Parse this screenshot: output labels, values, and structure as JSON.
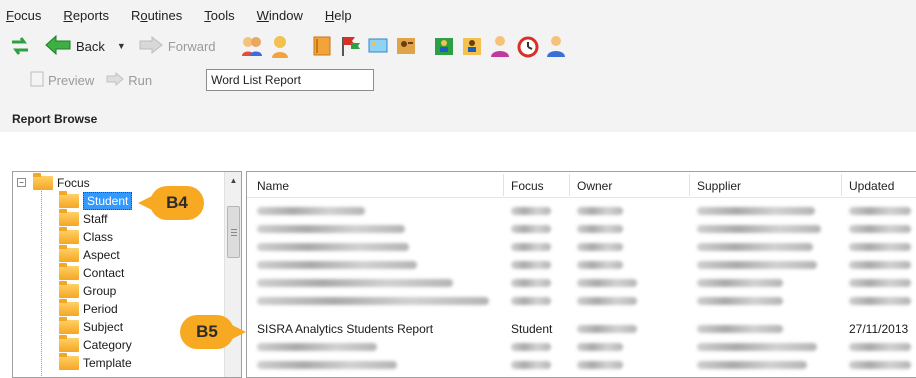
{
  "menu": [
    {
      "label": "Focus",
      "accel": "F",
      "rest": "ocus"
    },
    {
      "label": "Reports",
      "accel": "R",
      "rest": "eports"
    },
    {
      "label": "Routines",
      "accel": "o",
      "pre": "R",
      "rest": "utines"
    },
    {
      "label": "Tools",
      "accel": "T",
      "rest": "ools"
    },
    {
      "label": "Window",
      "accel": "W",
      "rest": "indow"
    },
    {
      "label": "Help",
      "accel": "H",
      "rest": "elp"
    }
  ],
  "toolbar": {
    "back_label": "Back",
    "forward_label": "Forward"
  },
  "runbar": {
    "preview_label": "Preview",
    "run_label": "Run",
    "report_name_value": "Word List Report"
  },
  "section_title": "Report Browse",
  "tree": {
    "root": "Focus",
    "items": [
      "Student",
      "Staff",
      "Class",
      "Aspect",
      "Contact",
      "Group",
      "Period",
      "Subject",
      "Category",
      "Template"
    ],
    "selected": "Student"
  },
  "list": {
    "columns": [
      "Name",
      "Focus",
      "Owner",
      "Supplier",
      "Updated"
    ],
    "highlight_row": {
      "name": "SISRA Analytics Students Report",
      "focus": "Student",
      "updated": "27/11/2013"
    }
  },
  "callouts": {
    "b4": "B4",
    "b5": "B5"
  },
  "colors": {
    "callout": "#f7a922",
    "selection": "#3399ff",
    "chrome": "#f3f3f3"
  }
}
